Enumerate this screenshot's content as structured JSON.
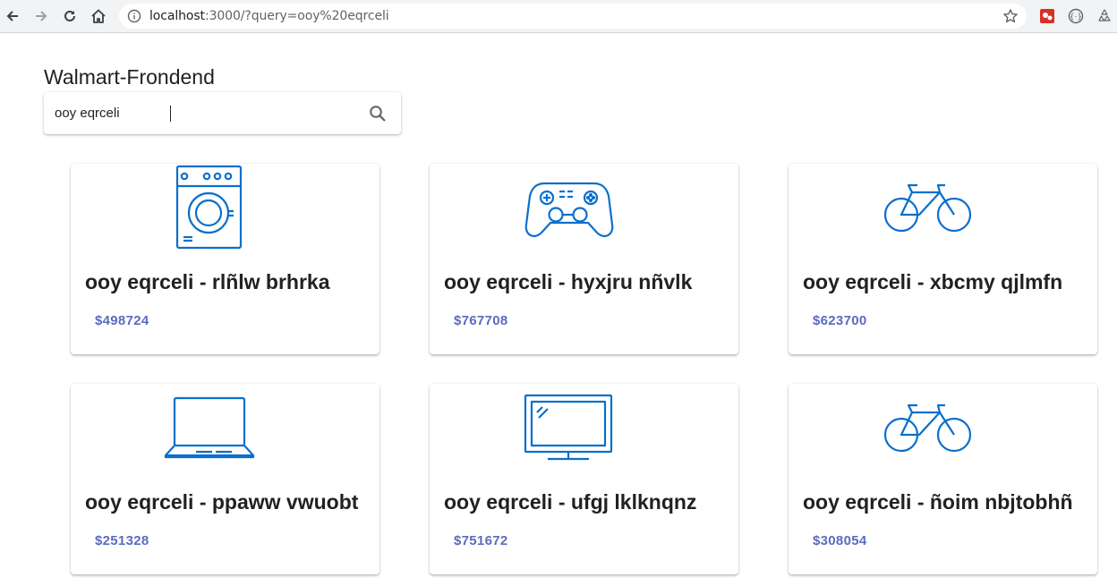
{
  "browser": {
    "url_host": "localhost",
    "url_rest": ":3000/?query=ooy%20eqrceli"
  },
  "page": {
    "brand": "Walmart-Frondend"
  },
  "search": {
    "value": "ooy eqrceli"
  },
  "products": [
    {
      "icon": "washing-machine-icon",
      "title": "ooy eqrceli - rlñlw brhrka",
      "price": "$498724"
    },
    {
      "icon": "gamepad-icon",
      "title": "ooy eqrceli - hyxjru nñvlk",
      "price": "$767708"
    },
    {
      "icon": "bicycle-icon",
      "title": "ooy eqrceli - xbcmy qjlmfn",
      "price": "$623700"
    },
    {
      "icon": "laptop-icon",
      "title": "ooy eqrceli - ppaww vwuobt",
      "price": "$251328"
    },
    {
      "icon": "monitor-icon",
      "title": "ooy eqrceli - ufgj lklknqnz",
      "price": "$751672"
    },
    {
      "icon": "bicycle-icon",
      "title": "ooy eqrceli - ñoim nbjtobhñ",
      "price": "$308054"
    }
  ],
  "colors": {
    "icon_blue": "#0a6fcc",
    "price_indigo": "#3f51b5",
    "chrome_bg": "#f1f3f4"
  }
}
